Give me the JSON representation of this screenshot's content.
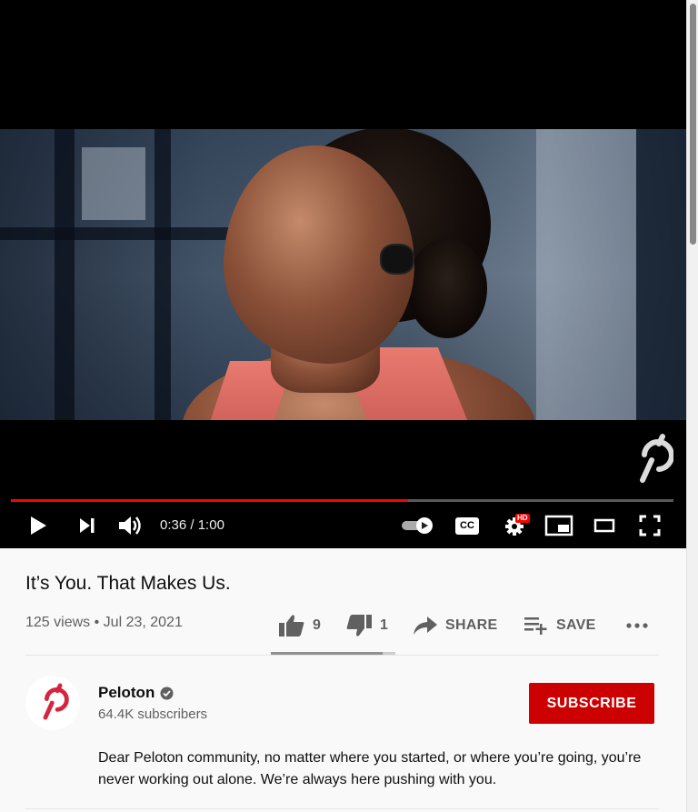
{
  "player": {
    "time_current": "0:36",
    "time_separator": " / ",
    "time_total": "1:00",
    "progress_fraction": 0.6,
    "hd_badge": "HD",
    "cc_label": "CC",
    "accent_color": "#ff0000"
  },
  "video": {
    "title": "It’s You. That Makes Us.",
    "views": "125 views",
    "bullet": "•",
    "date": "Jul 23, 2021",
    "likes": "9",
    "dislikes": "1",
    "share_label": "SHARE",
    "save_label": "SAVE",
    "like_ratio": 0.9
  },
  "channel": {
    "name": "Peloton",
    "subscribers": "64.4K subscribers",
    "subscribe_label": "SUBSCRIBE",
    "brand_color": "#cc0000"
  },
  "description": {
    "text": "Dear Peloton community, no matter where you started, or where you’re going, you’re never working out alone. We’re always here pushing with you."
  },
  "icons": [
    "play-icon",
    "next-icon",
    "volume-icon",
    "autoplay-toggle",
    "cc-icon",
    "settings-icon",
    "miniplayer-icon",
    "theater-icon",
    "fullscreen-icon",
    "like-icon",
    "dislike-icon",
    "share-icon",
    "save-icon",
    "more-icon",
    "verified-icon",
    "peloton-logo"
  ]
}
